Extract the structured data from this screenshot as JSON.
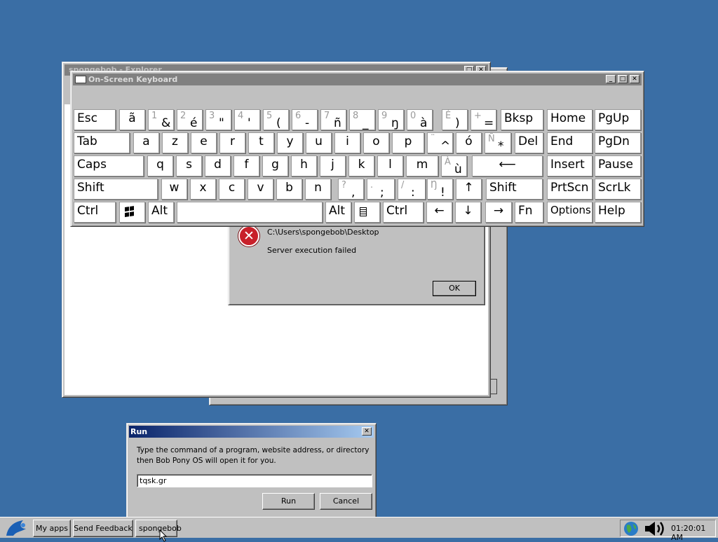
{
  "explorer_window": {
    "title": "spongebob - Explorer"
  },
  "error_dialog": {
    "path": "C:\\Users\\spongebob\\Desktop",
    "message": "Server execution failed",
    "ok_label": "OK"
  },
  "keyboard": {
    "title": "On-Screen Keyboard",
    "rows": [
      [
        {
          "id": "esc",
          "main": "Esc"
        },
        {
          "id": "tilde",
          "main": "ã"
        },
        {
          "id": "1",
          "sub": "1",
          "low": "&"
        },
        {
          "id": "2",
          "sub": "2",
          "low": "é"
        },
        {
          "id": "3",
          "sub": "3",
          "low": "\""
        },
        {
          "id": "4",
          "sub": "4",
          "low": "'"
        },
        {
          "id": "5",
          "sub": "5",
          "low": "("
        },
        {
          "id": "6",
          "sub": "6",
          "low": "-"
        },
        {
          "id": "7",
          "sub": "7",
          "low": "ñ"
        },
        {
          "id": "8",
          "sub": "8",
          "low": "_"
        },
        {
          "id": "9",
          "sub": "9",
          "low": "ŋ"
        },
        {
          "id": "0",
          "sub": "0",
          "low": "à"
        },
        {
          "id": "eacute",
          "sub": "É",
          "low": ")"
        },
        {
          "id": "plus",
          "sub": "+",
          "low": "="
        },
        {
          "id": "bksp",
          "main": "Bksp"
        },
        {
          "id": "home",
          "main": "Home"
        },
        {
          "id": "pgup",
          "main": "PgUp"
        }
      ],
      [
        {
          "id": "tab",
          "main": "Tab"
        },
        {
          "id": "a",
          "main": "a"
        },
        {
          "id": "z",
          "main": "z"
        },
        {
          "id": "e",
          "main": "e"
        },
        {
          "id": "r",
          "main": "r"
        },
        {
          "id": "t",
          "main": "t"
        },
        {
          "id": "y",
          "main": "y"
        },
        {
          "id": "u",
          "main": "u"
        },
        {
          "id": "i",
          "main": "i"
        },
        {
          "id": "o",
          "main": "o"
        },
        {
          "id": "p",
          "main": "p"
        },
        {
          "id": "caret",
          "sub": "¨",
          "low": "^"
        },
        {
          "id": "oacute",
          "main": "ó"
        },
        {
          "id": "ntilde",
          "sub": "Ñ",
          "low": "*"
        },
        {
          "id": "del",
          "main": "Del"
        },
        {
          "id": "end",
          "main": "End"
        },
        {
          "id": "pgdn",
          "main": "PgDn"
        }
      ],
      [
        {
          "id": "caps",
          "main": "Caps"
        },
        {
          "id": "q",
          "main": "q"
        },
        {
          "id": "s",
          "main": "s"
        },
        {
          "id": "d",
          "main": "d"
        },
        {
          "id": "f",
          "main": "f"
        },
        {
          "id": "g",
          "main": "g"
        },
        {
          "id": "h",
          "main": "h"
        },
        {
          "id": "j",
          "main": "j"
        },
        {
          "id": "k",
          "main": "k"
        },
        {
          "id": "l",
          "main": "l"
        },
        {
          "id": "m",
          "main": "m"
        },
        {
          "id": "ugrave",
          "sub": "À",
          "low": "ù"
        },
        {
          "id": "enter",
          "main": "⟵"
        },
        {
          "id": "insert",
          "main": "Insert"
        },
        {
          "id": "pause",
          "main": "Pause"
        }
      ],
      [
        {
          "id": "lshift",
          "main": "Shift"
        },
        {
          "id": "w",
          "main": "w"
        },
        {
          "id": "x",
          "main": "x"
        },
        {
          "id": "c",
          "main": "c"
        },
        {
          "id": "v",
          "main": "v"
        },
        {
          "id": "b",
          "main": "b"
        },
        {
          "id": "n",
          "main": "n"
        },
        {
          "id": "comma",
          "sub": "?",
          "low": ","
        },
        {
          "id": "semicolon",
          "sub": ".",
          "low": ";"
        },
        {
          "id": "colon",
          "sub": "/",
          "low": ":"
        },
        {
          "id": "excl",
          "sub": "Ŋ",
          "low": "!"
        },
        {
          "id": "up",
          "main": "↑"
        },
        {
          "id": "rshift",
          "main": "Shift"
        },
        {
          "id": "prtscn",
          "main": "PrtScn"
        },
        {
          "id": "scrlk",
          "main": "ScrLk"
        }
      ],
      [
        {
          "id": "ctrl",
          "main": "Ctrl"
        },
        {
          "id": "win",
          "main": "windows-logo"
        },
        {
          "id": "alt",
          "main": "Alt"
        },
        {
          "id": "space",
          "main": ""
        },
        {
          "id": "altgr",
          "main": "Alt"
        },
        {
          "id": "menu",
          "main": "menu-icon"
        },
        {
          "id": "rctrl",
          "main": "Ctrl"
        },
        {
          "id": "left",
          "main": "←"
        },
        {
          "id": "down",
          "main": "↓"
        },
        {
          "id": "right",
          "main": "→"
        },
        {
          "id": "fn",
          "main": "Fn"
        },
        {
          "id": "options",
          "main": "Options"
        },
        {
          "id": "help",
          "main": "Help"
        }
      ]
    ]
  },
  "run_dialog": {
    "title": "Run",
    "description": "Type the command of a program, website address, or directory then Bob Pony OS will open it for you.",
    "input_value": "tqsk.gr",
    "run_label": "Run",
    "cancel_label": "Cancel"
  },
  "taskbar": {
    "items": [
      "My apps",
      "Send Feedback",
      "spongebob"
    ],
    "clock": "01:20:01 AM"
  },
  "colors": {
    "desktop": "#3a6ea5",
    "title_active": "#0a246a",
    "title_inactive": "#808080"
  }
}
